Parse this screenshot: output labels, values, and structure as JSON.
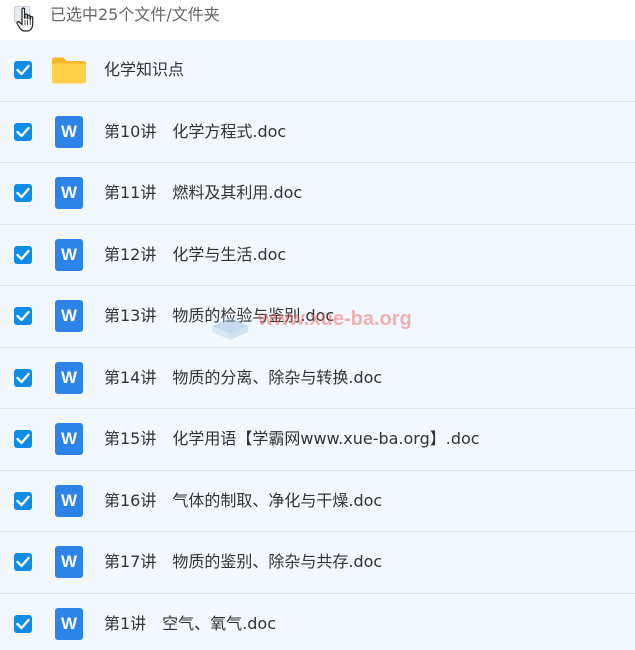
{
  "header": {
    "selection_text": "已选中25个文件/文件夹"
  },
  "colors": {
    "accent": "#0e8de8",
    "row_background": "#f3f8fe",
    "word_icon": "#2e83e8",
    "folder_icon": "#ffc940"
  },
  "items": [
    {
      "name": "化学知识点",
      "icon": "folder-icon",
      "checked": true
    },
    {
      "name": "第10讲　化学方程式.doc",
      "icon": "word-doc-icon",
      "checked": true
    },
    {
      "name": "第11讲　燃料及其利用.doc",
      "icon": "word-doc-icon",
      "checked": true
    },
    {
      "name": "第12讲　化学与生活.doc",
      "icon": "word-doc-icon",
      "checked": true
    },
    {
      "name": "第13讲　物质的检验与鉴别.doc",
      "icon": "word-doc-icon",
      "checked": true
    },
    {
      "name": "第14讲　物质的分离、除杂与转换.doc",
      "icon": "word-doc-icon",
      "checked": true
    },
    {
      "name": "第15讲　化学用语【学霸网www.xue-ba.org】.doc",
      "icon": "word-doc-icon",
      "checked": true
    },
    {
      "name": "第16讲　气体的制取、净化与干燥.doc",
      "icon": "word-doc-icon",
      "checked": true
    },
    {
      "name": "第17讲　物质的鉴别、除杂与共存.doc",
      "icon": "word-doc-icon",
      "checked": true
    },
    {
      "name": "第1讲　空气、氧气.doc",
      "icon": "word-doc-icon",
      "checked": true
    }
  ],
  "word_icon_letter": "W",
  "watermark": {
    "text": "www.xue-ba.org"
  }
}
